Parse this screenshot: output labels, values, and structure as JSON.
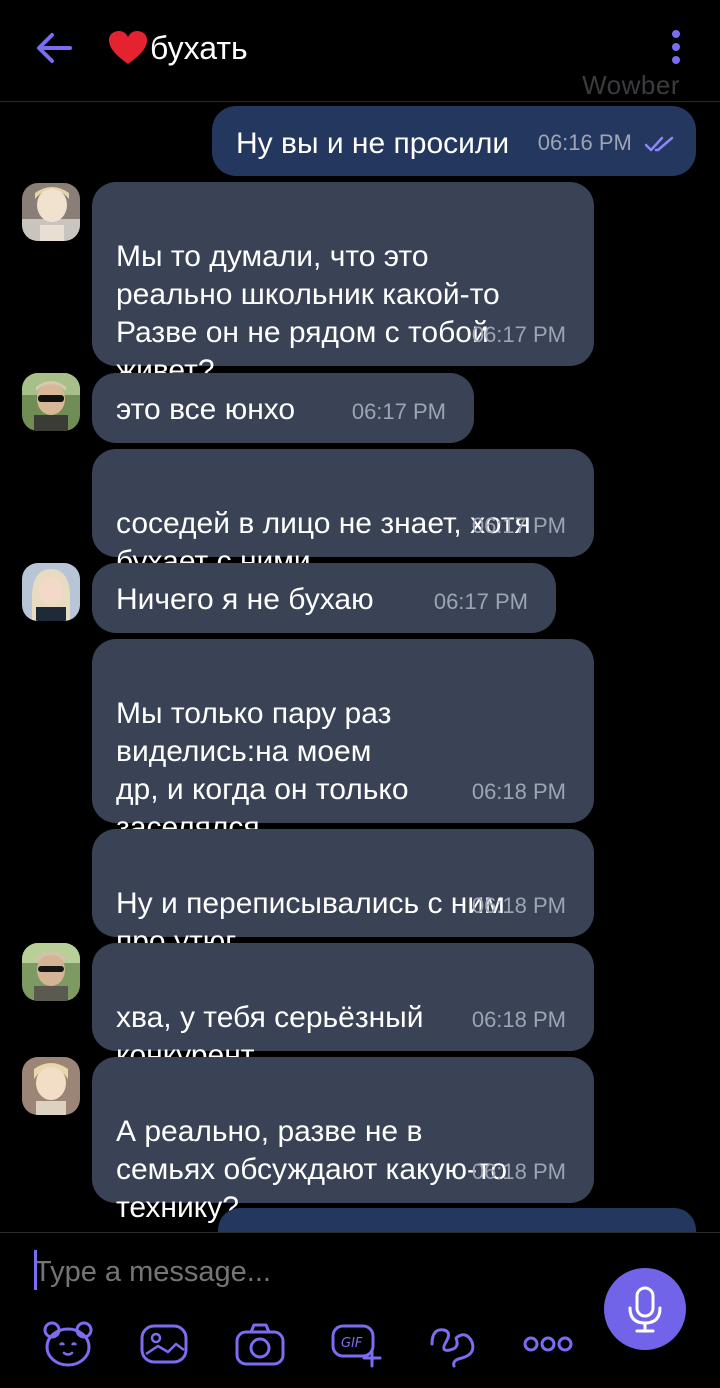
{
  "header": {
    "title": "бухать",
    "watermark": "Wowber"
  },
  "messages": [
    {
      "id": "m1",
      "direction": "out",
      "text": "Ну вы и не просили",
      "time": "06:16 PM",
      "status": "read"
    },
    {
      "id": "m2",
      "direction": "in",
      "text": "Мы то думали, что это\nреально школьник какой-то\nРазве он не рядом с тобой\nживет?",
      "time": "06:17 PM"
    },
    {
      "id": "m3",
      "direction": "in",
      "text": "это все юнхо",
      "time": "06:17 PM"
    },
    {
      "id": "m4",
      "direction": "in",
      "text": "соседей в лицо не знает, хотя\nбухает с ними",
      "time": "06:17 PM"
    },
    {
      "id": "m5",
      "direction": "in",
      "text": "Ничего я не бухаю",
      "time": "06:17 PM"
    },
    {
      "id": "m6",
      "direction": "in",
      "text": "Мы только пару раз\nвиделись:на моем\nдр, и когда он только\nзаселялся",
      "time": "06:18 PM"
    },
    {
      "id": "m7",
      "direction": "in",
      "text": "Ну и переписывались с ним\nпро утюг",
      "time": "06:18 PM"
    },
    {
      "id": "m8",
      "direction": "in",
      "text": "хва, у тебя серьёзный\nконкурент",
      "time": "06:18 PM"
    },
    {
      "id": "m9",
      "direction": "in",
      "text": "А реально, разве не в\nсемьях обсуждают какую-то\nтехнику?",
      "time": "06:18 PM"
    }
  ],
  "composer": {
    "placeholder": "Type a message..."
  },
  "icons": {
    "back": "arrow-left-icon",
    "menu": "more-vertical-icon",
    "stickers": "bear-sticker-icon",
    "gallery": "gallery-icon",
    "camera": "camera-icon",
    "gif": "gif-icon",
    "doodle": "doodle-icon",
    "more": "more-horizontal-icon",
    "mic": "microphone-icon"
  },
  "colors": {
    "accent": "#7264e8",
    "incoming_bubble": "#3a4256",
    "outgoing_bubble": "#23375f",
    "background": "#000000"
  }
}
